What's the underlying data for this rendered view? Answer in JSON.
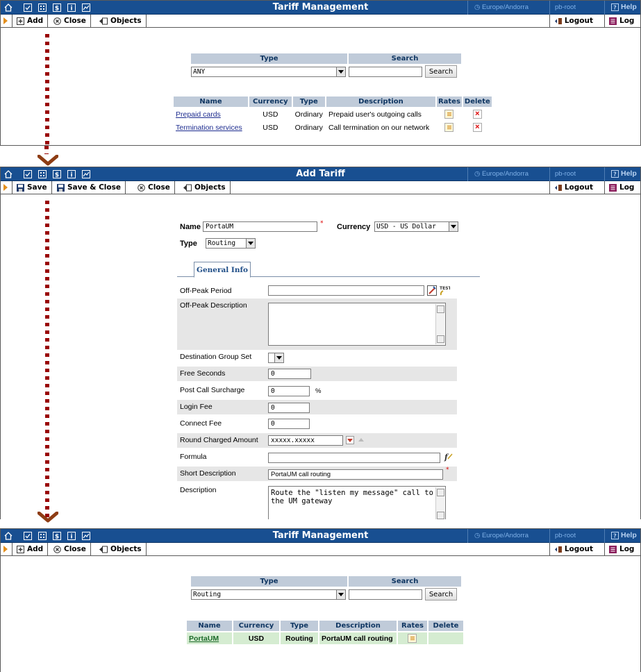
{
  "header": {
    "timezone": "Europe/Andorra",
    "user": "pb-root",
    "help": "Help"
  },
  "panel1": {
    "title": "Tariff Management",
    "toolbar": {
      "add": "Add",
      "close": "Close",
      "objects": "Objects",
      "logout": "Logout",
      "log": "Log"
    },
    "search": {
      "type_header": "Type",
      "search_header": "Search",
      "type_value": "ANY",
      "search_value": "",
      "search_button": "Search"
    },
    "list": {
      "columns": [
        "Name",
        "Currency",
        "Type",
        "Description",
        "Rates",
        "Delete"
      ],
      "rows": [
        {
          "name": "Prepaid cards",
          "currency": "USD",
          "type": "Ordinary",
          "description": "Prepaid user's outgoing calls"
        },
        {
          "name": "Termination services",
          "currency": "USD",
          "type": "Ordinary",
          "description": "Call termination on our network"
        }
      ]
    }
  },
  "panel2": {
    "title": "Add Tariff",
    "toolbar": {
      "save": "Save",
      "save_close": "Save & Close",
      "close": "Close",
      "objects": "Objects",
      "logout": "Logout",
      "log": "Log"
    },
    "form": {
      "name_label": "Name",
      "name_value": "PortaUM",
      "currency_label": "Currency",
      "currency_value": "USD - US Dollar",
      "type_label": "Type",
      "type_value": "Routing",
      "tab": "General Info",
      "offpeak_period": "Off-Peak Period",
      "offpeak_desc": "Off-Peak Description",
      "dest_group_set": "Destination Group Set",
      "free_seconds": "Free Seconds",
      "free_seconds_value": "0",
      "post_call": "Post Call Surcharge",
      "post_call_value": "0",
      "percent": "%",
      "login_fee": "Login Fee",
      "login_fee_value": "0",
      "connect_fee": "Connect Fee",
      "connect_fee_value": "0",
      "round_amount": "Round Charged Amount",
      "round_amount_value": "xxxxx.xxxxx",
      "formula": "Formula",
      "short_desc": "Short Description",
      "short_desc_value": "PortaUM call routing",
      "description": "Description",
      "description_value": "Route the \"listen my message\" call to the UM gateway"
    }
  },
  "panel3": {
    "title": "Tariff Management",
    "toolbar": {
      "add": "Add",
      "close": "Close",
      "objects": "Objects",
      "logout": "Logout",
      "log": "Log"
    },
    "search": {
      "type_header": "Type",
      "search_header": "Search",
      "type_value": "Routing",
      "search_value": "",
      "search_button": "Search"
    },
    "list": {
      "columns": [
        "Name",
        "Currency",
        "Type",
        "Description",
        "Rates",
        "Delete"
      ],
      "rows": [
        {
          "name": "PortaUM",
          "currency": "USD",
          "type": "Routing",
          "description": "PortaUM call routing"
        }
      ]
    }
  },
  "colors": {
    "header_bg": "#184f91",
    "arrow": "#8e3d14",
    "highlight_row": "#d5ecd1",
    "required": "#dd0000"
  }
}
